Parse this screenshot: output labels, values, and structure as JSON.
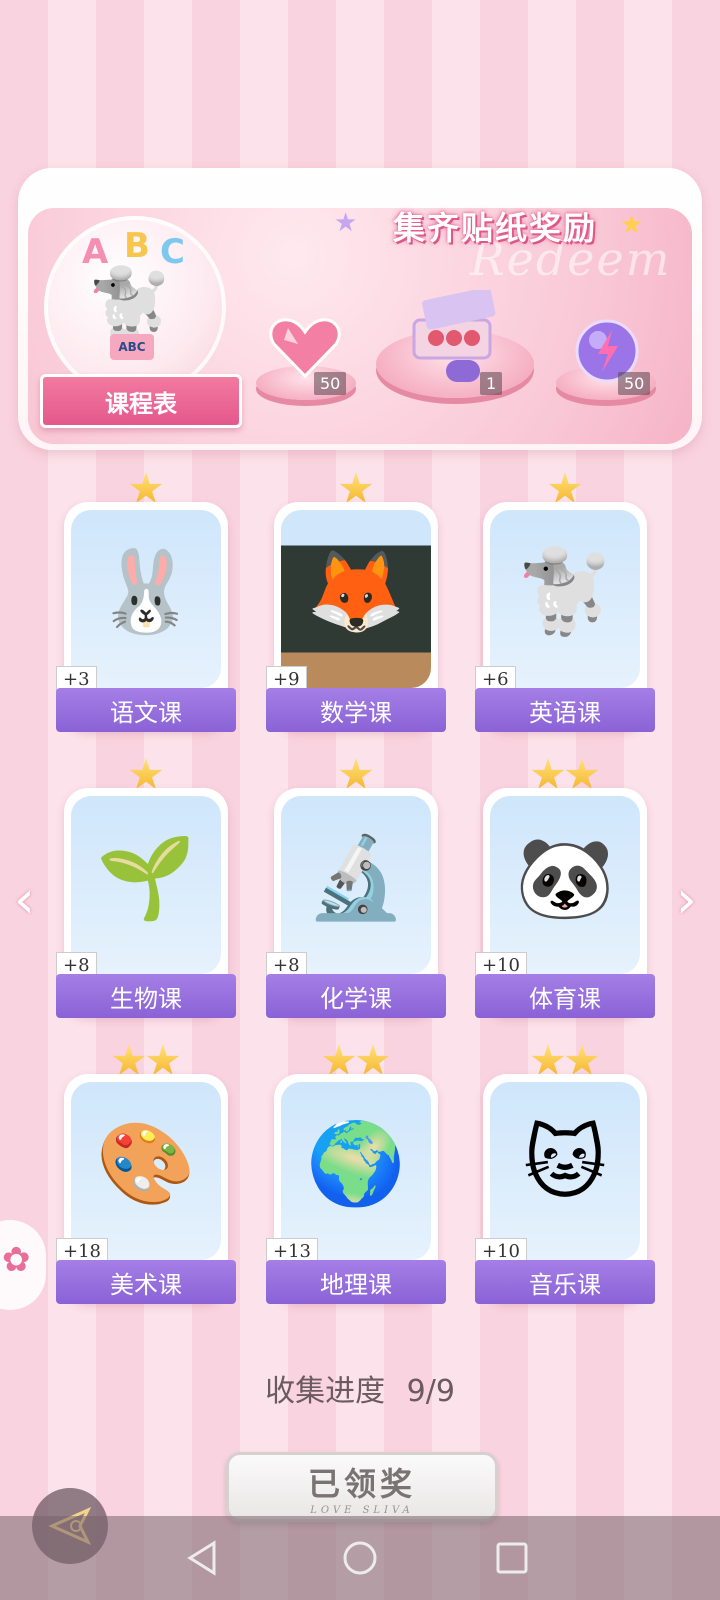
{
  "header": {
    "banner_title": "集齐贴纸奖励",
    "banner_watermark": "Redeem",
    "schedule_letters": [
      "A",
      "B",
      "C"
    ],
    "schedule_book_label": "ABC",
    "schedule_label": "课程表",
    "rewards": [
      {
        "name": "heart-gem-icon",
        "count": "50"
      },
      {
        "name": "gift-box-icon",
        "count": "1"
      },
      {
        "name": "lightning-orb-icon",
        "count": "50"
      }
    ]
  },
  "cards": [
    {
      "label": "语文课",
      "points": "+3",
      "stars": 1,
      "icon": "rabbit-calligraphy-icon",
      "glyph": "🐰",
      "accent": "#ffd1dc"
    },
    {
      "label": "数学课",
      "points": "+9",
      "stars": 1,
      "icon": "fox-teacher-icon",
      "glyph": "🦊",
      "accent": "#2f3a35"
    },
    {
      "label": "英语课",
      "points": "+6",
      "stars": 1,
      "icon": "poodle-abc-icon",
      "glyph": "🐩",
      "accent": "#cfe6fb"
    },
    {
      "label": "生物课",
      "points": "+8",
      "stars": 1,
      "icon": "sun-sprout-icon",
      "glyph": "🌱",
      "accent": "#cfe6fb"
    },
    {
      "label": "化学课",
      "points": "+8",
      "stars": 1,
      "icon": "microscope-icon",
      "glyph": "🔬",
      "accent": "#cfe6fb"
    },
    {
      "label": "体育课",
      "points": "+10",
      "stars": 2,
      "icon": "panda-pingpong-icon",
      "glyph": "🐼",
      "accent": "#cfe6fb"
    },
    {
      "label": "美术课",
      "points": "+18",
      "stars": 2,
      "icon": "cat-painter-icon",
      "glyph": "🎨",
      "accent": "#cfe6fb"
    },
    {
      "label": "地理课",
      "points": "+13",
      "stars": 2,
      "icon": "globe-icon",
      "glyph": "🌍",
      "accent": "#cfe6fb"
    },
    {
      "label": "音乐课",
      "points": "+10",
      "stars": 2,
      "icon": "cat-keytar-icon",
      "glyph": "🐱",
      "accent": "#cfe6fb"
    }
  ],
  "progress": {
    "label": "收集进度",
    "value": "9/9"
  },
  "claim_button": {
    "label": "已领奖",
    "sub": "LOVE SLIVA"
  },
  "nav": {
    "prev_arrow": "‹",
    "next_arrow": "›"
  }
}
